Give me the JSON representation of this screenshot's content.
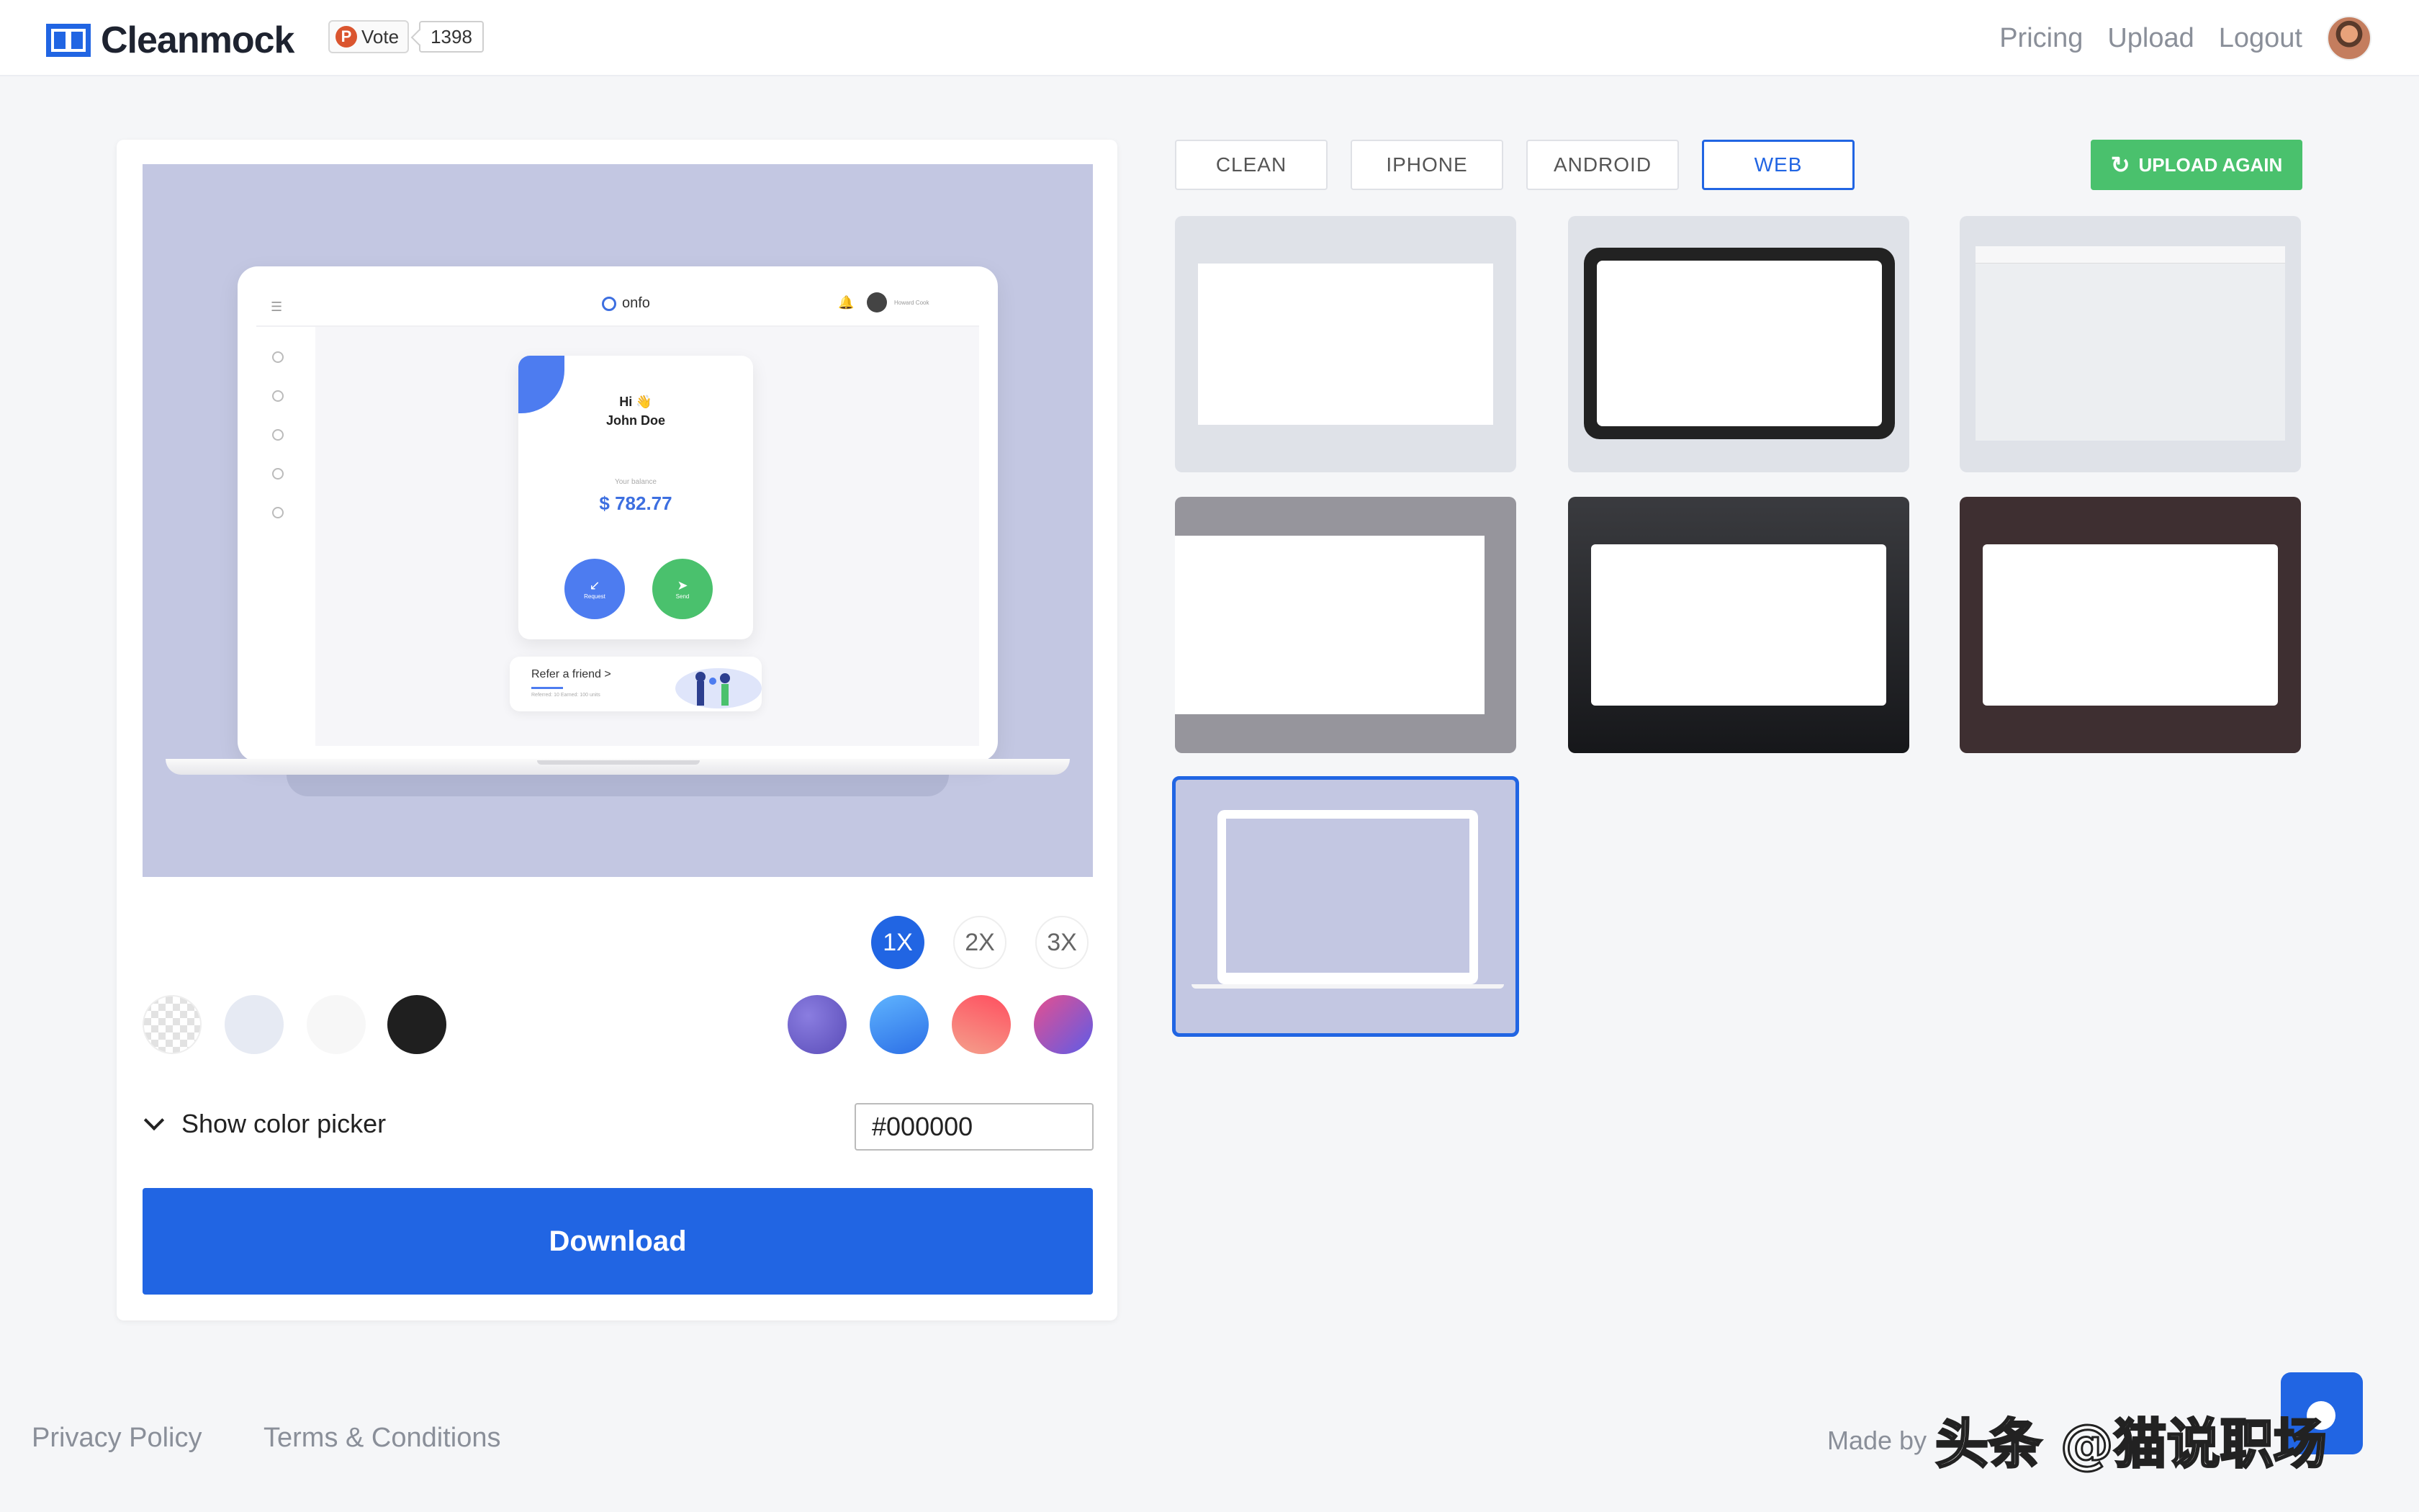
{
  "header": {
    "brand": "Cleanmock",
    "vote_label": "Vote",
    "vote_count": "1398",
    "nav": [
      "Pricing",
      "Upload",
      "Logout"
    ]
  },
  "preview": {
    "app_brand": "onfo",
    "app_user": "Howard Cook",
    "greeting": "Hi 👋",
    "name": "John Doe",
    "balance_label": "Your balance",
    "balance": "$ 782.77",
    "request_label": "Request",
    "send_label": "Send",
    "refer_title": "Refer a friend >",
    "refer_sub": "Referred: 10   Earned: 100 units"
  },
  "controls": {
    "scales": [
      "1X",
      "2X",
      "3X"
    ],
    "selected_scale": "1X",
    "swatches_solid": [
      "transparent",
      "#e6eaf3",
      "#f7f7f7",
      "#1f1f1f"
    ],
    "swatches_gradient": [
      "#6d5dc7",
      "#3d8ff0",
      "#f0515a",
      "#8a4fd0"
    ],
    "color_picker_label": "Show color picker",
    "hex_value": "#000000",
    "download_label": "Download"
  },
  "tabs": [
    "CLEAN",
    "IPHONE",
    "ANDROID",
    "WEB"
  ],
  "active_tab": "WEB",
  "upload_again_label": "UPLOAD AGAIN",
  "colors": {
    "accent": "#2165e3",
    "green": "#4ac16d",
    "preview_bg": "#c3c7e2"
  },
  "footer": {
    "links": [
      "Privacy Policy",
      "Terms & Conditions"
    ],
    "made_by": "Made by",
    "watermark": "头条 @猫说职场"
  }
}
